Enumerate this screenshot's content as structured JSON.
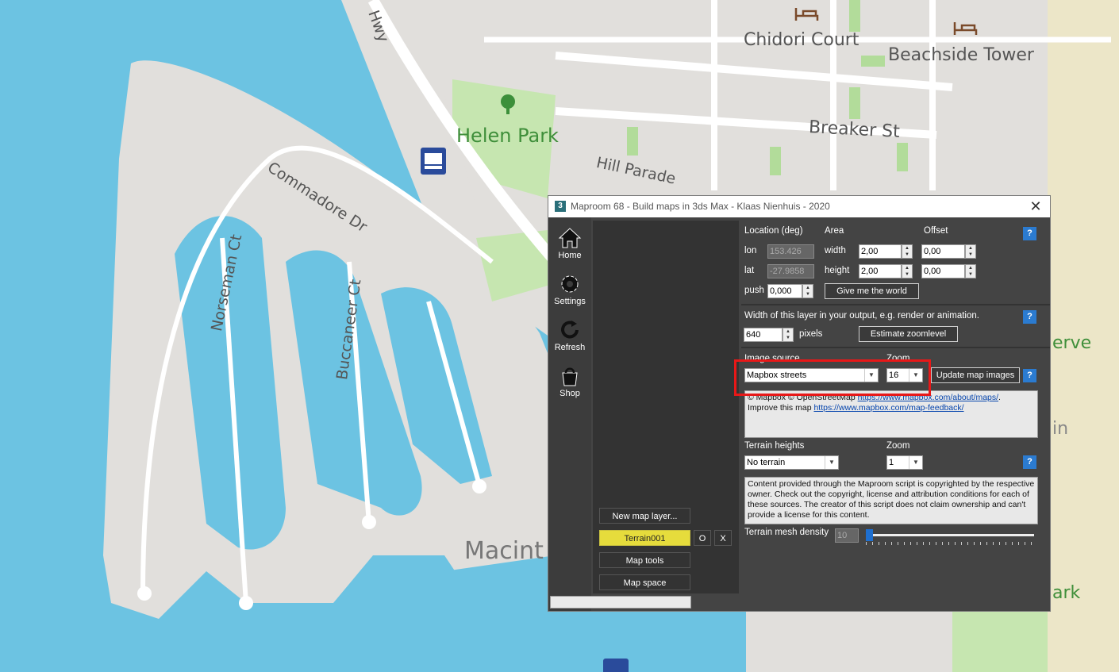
{
  "map": {
    "labels": {
      "hwy": "Hwy",
      "chidori": "Chidori Court",
      "beachside": "Beachside Tower",
      "helen_park": "Helen Park",
      "breaker": "Breaker St",
      "hill_parade": "Hill Parade",
      "commodore": "Commadore Dr",
      "norseman": "Norseman Ct",
      "buccaneer": "Buccaneer Ct",
      "macint": "Macint",
      "erve": "erve",
      "in": "in",
      "ark": "ark"
    },
    "colors": {
      "water": "#6cc3e2",
      "land": "#e1dfdc",
      "park": "#c6e6b0",
      "road": "#ffffff"
    }
  },
  "window": {
    "title": "Maproom 68 - Build maps in 3ds Max - Klaas Nienhuis - 2020",
    "icon_label": "3",
    "close_icon": "close-icon"
  },
  "sidebar": {
    "items": [
      {
        "label": "Home",
        "icon": "home-icon"
      },
      {
        "label": "Settings",
        "icon": "gear-icon"
      },
      {
        "label": "Refresh",
        "icon": "refresh-icon"
      },
      {
        "label": "Shop",
        "icon": "shopping-bag-icon"
      }
    ]
  },
  "layers": {
    "new_layer": "New map layer...",
    "terrain": "Terrain001",
    "o_btn": "O",
    "x_btn": "X",
    "map_tools": "Map tools",
    "map_space": "Map space"
  },
  "location": {
    "heading": "Location (deg)",
    "lon_label": "lon",
    "lon_value": "153.426",
    "lat_label": "lat",
    "lat_value": "-27.9858",
    "push_label": "push",
    "push_value": "0,000"
  },
  "area": {
    "heading": "Area",
    "width_label": "width",
    "width_value": "2,00",
    "height_label": "height",
    "height_value": "2,00",
    "world_button": "Give me the world"
  },
  "offset": {
    "heading": "Offset",
    "x_value": "0,00",
    "y_value": "0,00"
  },
  "output": {
    "description": "Width of this layer in your output, e.g. render or animation.",
    "pixels_value": "640",
    "pixels_label": "pixels",
    "estimate_button": "Estimate zoomlevel"
  },
  "image_source": {
    "heading": "Image source",
    "zoom_heading": "Zoom",
    "source_value": "Mapbox streets",
    "zoom_value": "16",
    "update_button": "Update map images",
    "attr_prefix": "© Mapbox © OpenStreetMap ",
    "attr_link1": "https://www.mapbox.com/about/maps/",
    "attr_mid": "Improve this map ",
    "attr_link2": "https://www.mapbox.com/map-feedback/"
  },
  "terrain": {
    "heading": "Terrain heights",
    "zoom_heading": "Zoom",
    "source_value": "No terrain",
    "zoom_value": "1",
    "disclaimer": "Content provided through the Maproom script is copyrighted by the respective owner. Check out the copyright, license and attribution conditions for each of these sources. The creator of this script does not claim ownership and can't provide a license for this content.",
    "density_label": "Terrain mesh density",
    "density_value": "10",
    "density_level": 0
  },
  "help_label": "?"
}
